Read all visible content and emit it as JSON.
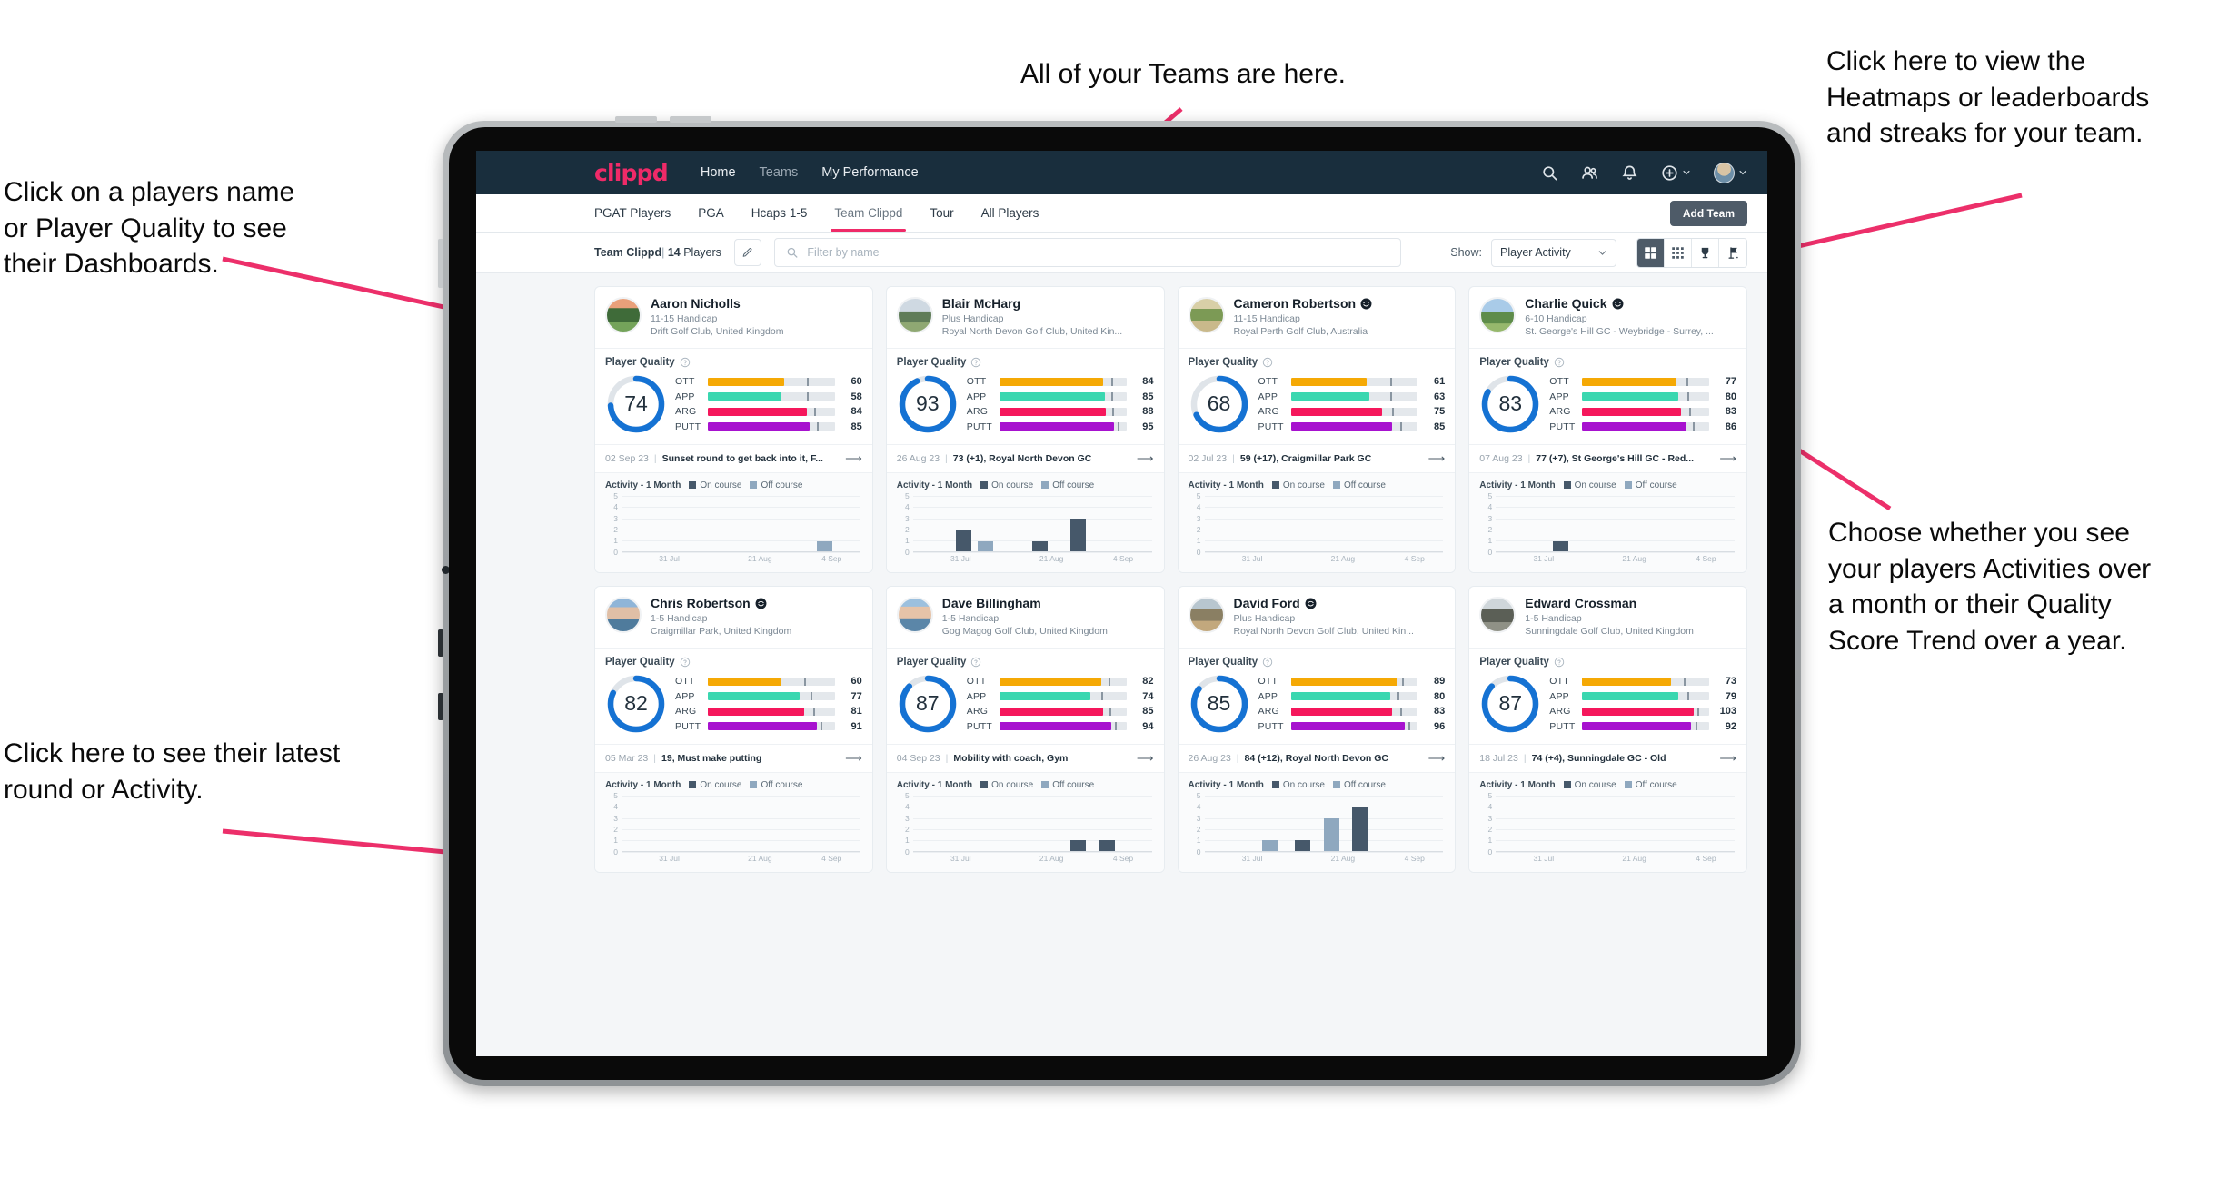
{
  "annotations": [
    {
      "id": "a-teams",
      "text": "All of your Teams are here."
    },
    {
      "id": "a-heatmaps",
      "text": "Click here to view the\nHeatmaps or leaderboards\nand streaks for your team."
    },
    {
      "id": "a-players",
      "text": "Click on a players name\nor Player Quality to see\ntheir Dashboards."
    },
    {
      "id": "a-choose",
      "text": "Choose whether you see\nyour players Activities over\na month or their Quality\nScore Trend over a year."
    },
    {
      "id": "a-latest",
      "text": "Click here to see their latest\nround or Activity."
    }
  ],
  "colors": {
    "brand_pink": "#ef2a68",
    "nav_bg": "#192e3d",
    "gauge_blue": "#1572d3",
    "ott": "#f5a905",
    "app": "#3ad7b0",
    "arg": "#f5175c",
    "putt": "#a712cf",
    "on_course": "#46586a",
    "off_course": "#8fa8bf"
  },
  "nav": {
    "logo": "clippd",
    "links": [
      {
        "label": "Home",
        "active": true
      },
      {
        "label": "Teams",
        "active": false
      },
      {
        "label": "My Performance",
        "active": true
      }
    ],
    "icons": [
      "search-icon",
      "people-icon",
      "bell-icon",
      "plus-circle-icon",
      "avatar"
    ]
  },
  "tabs": {
    "items": [
      {
        "label": "PGAT Players",
        "active": false
      },
      {
        "label": "PGA",
        "active": false
      },
      {
        "label": "Hcaps 1-5",
        "active": false
      },
      {
        "label": "Team Clippd",
        "active": true
      },
      {
        "label": "Tour",
        "active": false
      },
      {
        "label": "All Players",
        "active": false
      }
    ],
    "add_team_label": "Add Team"
  },
  "toolbar": {
    "team_name": "Team Clippd",
    "separator": "|",
    "player_count": "14",
    "players_word": "Players",
    "edit_icon": "pencil-icon",
    "search_placeholder": "Filter by name",
    "search_value": "",
    "show_label": "Show:",
    "show_value": "Player Activity",
    "show_options": [
      "Player Activity",
      "Quality Score Trend"
    ],
    "views": [
      {
        "name": "grid-view-button",
        "icon": "grid-large-icon",
        "active": true
      },
      {
        "name": "compact-view-button",
        "icon": "grid-small-icon",
        "active": false
      },
      {
        "name": "leaderboard-view-button",
        "icon": "trophy-icon",
        "active": false
      },
      {
        "name": "course-view-button",
        "icon": "flag-icon",
        "active": false
      }
    ]
  },
  "activity": {
    "title": "Activity - 1 Month",
    "legend": [
      {
        "label": "On course",
        "color": "#46586a"
      },
      {
        "label": "Off course",
        "color": "#8fa8bf"
      }
    ],
    "y_ticks": [
      "5",
      "4",
      "3",
      "2",
      "1",
      "0"
    ],
    "y_max": 5,
    "x_ticks": [
      "31 Jul",
      "21 Aug",
      "4 Sep"
    ]
  },
  "quality": {
    "title": "Player Quality",
    "help_icon": "question-circle-icon",
    "metric_labels": [
      "OTT",
      "APP",
      "ARG",
      "PUTT"
    ]
  },
  "chart_data": {
    "type": "bar",
    "title": "Activity - 1 Month",
    "xlabel": "",
    "ylabel": "",
    "ylim": [
      0,
      5
    ],
    "grid": true,
    "legend_position": "top",
    "x_tick_labels": [
      "31 Jul",
      "21 Aug",
      "4 Sep"
    ],
    "series": [
      {
        "name": "On course",
        "color": "#46586a"
      },
      {
        "name": "Off course",
        "color": "#8fa8bf"
      }
    ]
  },
  "players": [
    {
      "name": "Aaron Nicholls",
      "verified": false,
      "handicap": "11-15 Handicap",
      "club": "Drift Golf Club, United Kingdom",
      "quality_score": 74,
      "gauge_pct": 74,
      "metrics": [
        {
          "label": "OTT",
          "value": 60,
          "fill": 60,
          "tick": 78
        },
        {
          "label": "APP",
          "value": 58,
          "fill": 58,
          "tick": 78
        },
        {
          "label": "ARG",
          "value": 84,
          "fill": 78,
          "tick": 84
        },
        {
          "label": "PUTT",
          "value": 85,
          "fill": 80,
          "tick": 86
        }
      ],
      "latest_date": "02 Sep 23",
      "latest_text": "Sunset round to get back into it, F...",
      "bars": [
        {
          "x": 82,
          "h": 1,
          "type": "off"
        }
      ]
    },
    {
      "name": "Blair McHarg",
      "verified": false,
      "handicap": "Plus Handicap",
      "club": "Royal North Devon Golf Club, United Kin...",
      "quality_score": 93,
      "gauge_pct": 93,
      "metrics": [
        {
          "label": "OTT",
          "value": 84,
          "fill": 82,
          "tick": 88
        },
        {
          "label": "APP",
          "value": 85,
          "fill": 83,
          "tick": 88
        },
        {
          "label": "ARG",
          "value": 88,
          "fill": 84,
          "tick": 89
        },
        {
          "label": "PUTT",
          "value": 95,
          "fill": 90,
          "tick": 93
        }
      ],
      "latest_date": "26 Aug 23",
      "latest_text": "73 (+1), Royal North Devon GC",
      "bars": [
        {
          "x": 18,
          "h": 2,
          "type": "on"
        },
        {
          "x": 27,
          "h": 1,
          "type": "off"
        },
        {
          "x": 50,
          "h": 1,
          "type": "on"
        },
        {
          "x": 66,
          "h": 3,
          "type": "on"
        }
      ]
    },
    {
      "name": "Cameron Robertson",
      "verified": true,
      "handicap": "11-15 Handicap",
      "club": "Royal Perth Golf Club, Australia",
      "quality_score": 68,
      "gauge_pct": 68,
      "metrics": [
        {
          "label": "OTT",
          "value": 61,
          "fill": 60,
          "tick": 78
        },
        {
          "label": "APP",
          "value": 63,
          "fill": 62,
          "tick": 78
        },
        {
          "label": "ARG",
          "value": 75,
          "fill": 72,
          "tick": 80
        },
        {
          "label": "PUTT",
          "value": 85,
          "fill": 80,
          "tick": 86
        }
      ],
      "latest_date": "02 Jul 23",
      "latest_text": "59 (+17), Craigmillar Park GC",
      "bars": []
    },
    {
      "name": "Charlie Quick",
      "verified": true,
      "handicap": "6-10 Handicap",
      "club": "St. George's Hill GC - Weybridge - Surrey, ...",
      "quality_score": 83,
      "gauge_pct": 83,
      "metrics": [
        {
          "label": "OTT",
          "value": 77,
          "fill": 74,
          "tick": 82
        },
        {
          "label": "APP",
          "value": 80,
          "fill": 76,
          "tick": 83
        },
        {
          "label": "ARG",
          "value": 83,
          "fill": 78,
          "tick": 84
        },
        {
          "label": "PUTT",
          "value": 86,
          "fill": 82,
          "tick": 87
        }
      ],
      "latest_date": "07 Aug 23",
      "latest_text": "77 (+7), St George's Hill GC - Red...",
      "bars": [
        {
          "x": 24,
          "h": 1,
          "type": "on"
        }
      ]
    },
    {
      "name": "Chris Robertson",
      "verified": true,
      "handicap": "1-5 Handicap",
      "club": "Craigmillar Park, United Kingdom",
      "quality_score": 82,
      "gauge_pct": 82,
      "metrics": [
        {
          "label": "OTT",
          "value": 60,
          "fill": 58,
          "tick": 76
        },
        {
          "label": "APP",
          "value": 77,
          "fill": 72,
          "tick": 81
        },
        {
          "label": "ARG",
          "value": 81,
          "fill": 76,
          "tick": 83
        },
        {
          "label": "PUTT",
          "value": 91,
          "fill": 86,
          "tick": 89
        }
      ],
      "latest_date": "05 Mar 23",
      "latest_text": "19, Must make putting",
      "bars": []
    },
    {
      "name": "Dave Billingham",
      "verified": false,
      "handicap": "1-5 Handicap",
      "club": "Gog Magog Golf Club, United Kingdom",
      "quality_score": 87,
      "gauge_pct": 87,
      "metrics": [
        {
          "label": "OTT",
          "value": 82,
          "fill": 80,
          "tick": 86
        },
        {
          "label": "APP",
          "value": 74,
          "fill": 72,
          "tick": 80
        },
        {
          "label": "ARG",
          "value": 85,
          "fill": 82,
          "tick": 87
        },
        {
          "label": "PUTT",
          "value": 94,
          "fill": 88,
          "tick": 91
        }
      ],
      "latest_date": "04 Sep 23",
      "latest_text": "Mobility with coach, Gym",
      "bars": [
        {
          "x": 66,
          "h": 1,
          "type": "on"
        },
        {
          "x": 78,
          "h": 1,
          "type": "on"
        }
      ]
    },
    {
      "name": "David Ford",
      "verified": true,
      "handicap": "Plus Handicap",
      "club": "Royal North Devon Golf Club, United Kin...",
      "quality_score": 85,
      "gauge_pct": 85,
      "metrics": [
        {
          "label": "OTT",
          "value": 89,
          "fill": 84,
          "tick": 88
        },
        {
          "label": "APP",
          "value": 80,
          "fill": 78,
          "tick": 84
        },
        {
          "label": "ARG",
          "value": 83,
          "fill": 80,
          "tick": 86
        },
        {
          "label": "PUTT",
          "value": 96,
          "fill": 90,
          "tick": 93
        }
      ],
      "latest_date": "26 Aug 23",
      "latest_text": "84 (+12), Royal North Devon GC",
      "bars": [
        {
          "x": 24,
          "h": 1,
          "type": "off"
        },
        {
          "x": 38,
          "h": 1,
          "type": "on"
        },
        {
          "x": 50,
          "h": 3,
          "type": "off"
        },
        {
          "x": 62,
          "h": 4,
          "type": "on"
        }
      ]
    },
    {
      "name": "Edward Crossman",
      "verified": false,
      "handicap": "1-5 Handicap",
      "club": "Sunningdale Golf Club, United Kingdom",
      "quality_score": 87,
      "gauge_pct": 87,
      "metrics": [
        {
          "label": "OTT",
          "value": 73,
          "fill": 70,
          "tick": 80
        },
        {
          "label": "APP",
          "value": 79,
          "fill": 76,
          "tick": 83
        },
        {
          "label": "ARG",
          "value": 103,
          "fill": 88,
          "tick": 91
        },
        {
          "label": "PUTT",
          "value": 92,
          "fill": 86,
          "tick": 89
        }
      ],
      "latest_date": "18 Jul 23",
      "latest_text": "74 (+4), Sunningdale GC - Old",
      "bars": []
    }
  ]
}
